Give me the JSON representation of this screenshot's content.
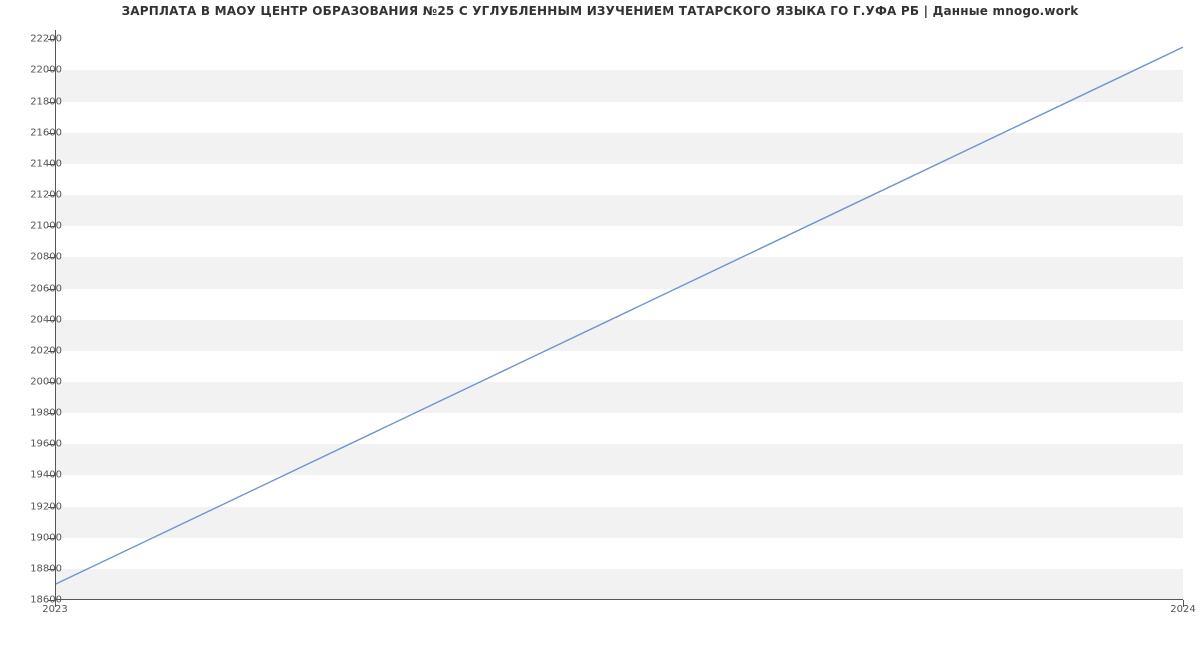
{
  "chart_data": {
    "type": "line",
    "title": "ЗАРПЛАТА В МАОУ ЦЕНТР ОБРАЗОВАНИЯ №25 С УГЛУБЛЕННЫМ ИЗУЧЕНИЕМ ТАТАРСКОГО ЯЗЫКА ГО Г.УФА РБ | Данные mnogo.work",
    "xlabel": "",
    "ylabel": "",
    "x_ticks": [
      "2023",
      "2024"
    ],
    "y_ticks": [
      18600,
      18800,
      19000,
      19200,
      19400,
      19600,
      19800,
      20000,
      20200,
      20400,
      20600,
      20800,
      21000,
      21200,
      21400,
      21600,
      21800,
      22000,
      22200
    ],
    "ylim": [
      18600,
      22260
    ],
    "xlim_index": [
      0,
      1
    ],
    "series": [
      {
        "name": "salary",
        "color": "#6f94d1",
        "x": [
          "2023",
          "2024"
        ],
        "y": [
          18700,
          22150
        ]
      }
    ],
    "band_color": "#f2f2f2"
  }
}
